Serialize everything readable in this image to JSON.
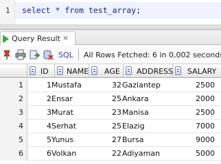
{
  "editor": {
    "line_number": "1",
    "code_keyword": "select",
    "code_rest": " * ",
    "code_keyword2": "from",
    "code_table": " test_array;"
  },
  "tab": {
    "label": "Query Result",
    "close": "×"
  },
  "toolbar": {
    "icons": [
      "pin-icon",
      "print-icon",
      "export-icon",
      "db-icon"
    ],
    "sql_label": "SQL",
    "status": "All Rows Fetched: 6 in 0,002 seconds"
  },
  "grid": {
    "columns": [
      "ID",
      "NAME",
      "AGE",
      "ADDRESS",
      "SALARY"
    ],
    "rows": [
      {
        "n": "1",
        "id": "1",
        "name": "Mustafa",
        "age": "32",
        "address": "Gaziantep",
        "salary": "2500"
      },
      {
        "n": "2",
        "id": "2",
        "name": "Ensar",
        "age": "25",
        "address": "Ankara",
        "salary": "2000"
      },
      {
        "n": "3",
        "id": "3",
        "name": "Murat",
        "age": "23",
        "address": "Manisa",
        "salary": "2500"
      },
      {
        "n": "4",
        "id": "4",
        "name": "Serhat",
        "age": "25",
        "address": "Elazig",
        "salary": "7000"
      },
      {
        "n": "5",
        "id": "5",
        "name": "Yunus",
        "age": "27",
        "address": "Bursa",
        "salary": "9000"
      },
      {
        "n": "6",
        "id": "6",
        "name": "Volkan",
        "age": "22",
        "address": "Adiyaman",
        "salary": "5000"
      }
    ]
  }
}
